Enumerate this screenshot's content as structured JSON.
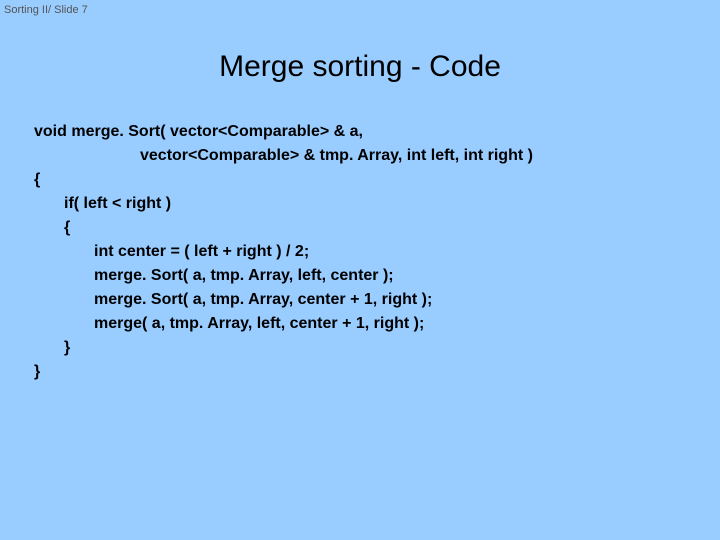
{
  "header": {
    "label": "Sorting II/ Slide 7"
  },
  "title": "Merge sorting - Code",
  "code": {
    "sig1": "void merge. Sort( vector<Comparable> & a,",
    "sig2": "vector<Comparable> & tmp. Array, int left, int right )",
    "l1": "{",
    "l2": "if( left < right )",
    "l3": "{",
    "l4": "int center = ( left + right ) / 2;",
    "l5": "merge. Sort( a, tmp. Array, left, center );",
    "l6": "merge. Sort( a, tmp. Array, center + 1, right );",
    "l7": "merge( a, tmp. Array, left, center + 1, right );",
    "l8": "}",
    "l9": "}"
  }
}
